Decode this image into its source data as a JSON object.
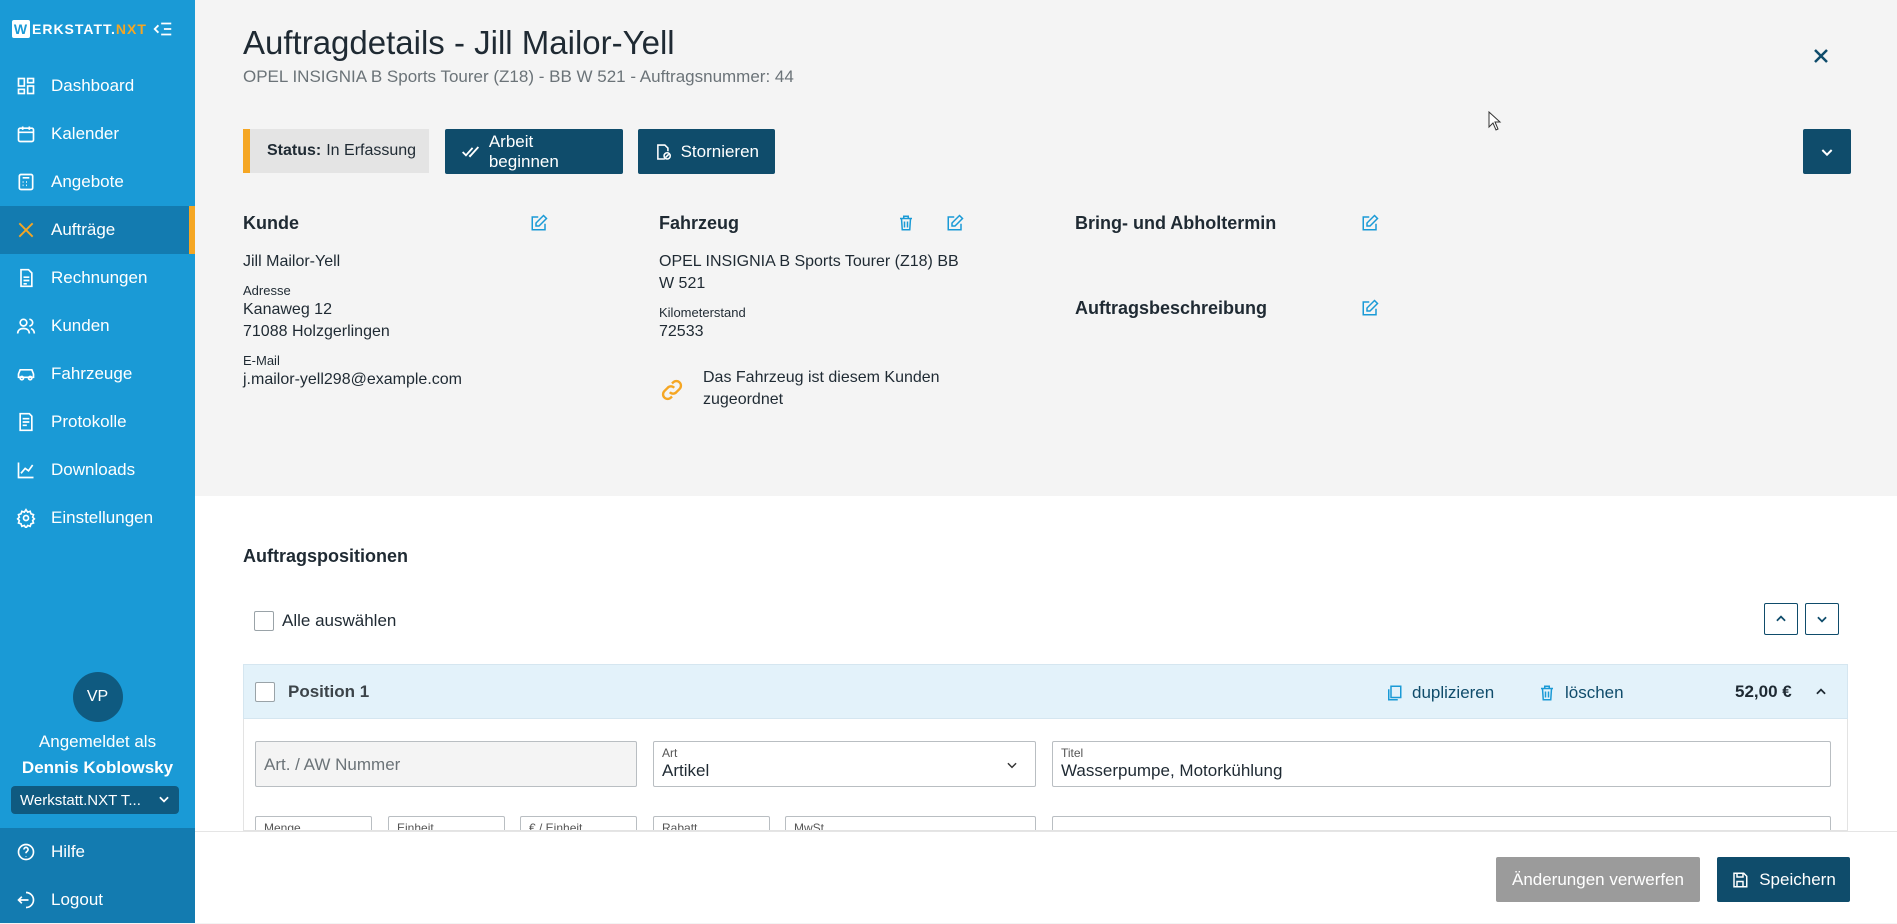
{
  "app": {
    "logo_w": "W",
    "logo_main": "ERKSTATT.",
    "logo_nxt": "NXT"
  },
  "sidebar": {
    "items": [
      {
        "label": "Dashboard",
        "icon": "dashboard-icon"
      },
      {
        "label": "Kalender",
        "icon": "calendar-icon"
      },
      {
        "label": "Angebote",
        "icon": "calculator-icon"
      },
      {
        "label": "Aufträge",
        "icon": "tools-icon"
      },
      {
        "label": "Rechnungen",
        "icon": "invoice-icon"
      },
      {
        "label": "Kunden",
        "icon": "users-icon"
      },
      {
        "label": "Fahrzeuge",
        "icon": "car-icon"
      },
      {
        "label": "Protokolle",
        "icon": "protocol-icon"
      },
      {
        "label": "Downloads",
        "icon": "chart-icon"
      },
      {
        "label": "Einstellungen",
        "icon": "gear-icon"
      }
    ],
    "active_index": 3,
    "user": {
      "initials": "VP",
      "logged_in_as": "Angemeldet als",
      "name": "Dennis Koblowsky"
    },
    "tenant": "Werkstatt.NXT T...",
    "bottom": [
      {
        "label": "Hilfe",
        "icon": "help-icon"
      },
      {
        "label": "Logout",
        "icon": "logout-icon"
      }
    ]
  },
  "header": {
    "title": "Auftragdetails - Jill Mailor-Yell",
    "subtitle": "OPEL INSIGNIA B Sports Tourer (Z18) - BB W 521 - Auftragsnummer: 44"
  },
  "status": {
    "label": "Status:",
    "value": "In Erfassung",
    "color": "#f5a623"
  },
  "actions": {
    "start": "Arbeit beginnen",
    "cancel": "Stornieren"
  },
  "customer": {
    "heading": "Kunde",
    "name": "Jill Mailor-Yell",
    "address_label": "Adresse",
    "street": "Kanaweg 12",
    "city": "71088 Holzgerlingen",
    "email_label": "E-Mail",
    "email": "j.mailor-yell298@example.com"
  },
  "vehicle": {
    "heading": "Fahrzeug",
    "name_line1": "OPEL INSIGNIA B Sports Tourer (Z18) BB",
    "name_line2": "W 521",
    "mileage_label": "Kilometerstand",
    "mileage": "72533",
    "link_line1": "Das Fahrzeug ist diesem Kunden",
    "link_line2": "zugeordnet"
  },
  "appointment": {
    "heading": "Bring- und Abholtermin"
  },
  "description": {
    "heading": "Auftragsbeschreibung"
  },
  "positions": {
    "heading": "Auftragspositionen",
    "select_all": "Alle auswählen",
    "items": [
      {
        "title": "Position 1",
        "duplicate": "duplizieren",
        "delete": "löschen",
        "amount": "52,00 €",
        "art_nr_placeholder": "Art. / AW Nummer",
        "type_label": "Art",
        "type_value": "Artikel",
        "title_label": "Titel",
        "title_value": "Wasserpumpe, Motorkühlung",
        "row2_labels": [
          "Menge",
          "Einheit",
          "€ / Einheit",
          "Rabatt",
          "MwSt."
        ]
      }
    ]
  },
  "footer": {
    "discard": "Änderungen verwerfen",
    "save": "Speichern"
  },
  "colors": {
    "sidebar": "#1a9ad6",
    "primary": "#0f4c6b",
    "accent": "#f5a623"
  }
}
